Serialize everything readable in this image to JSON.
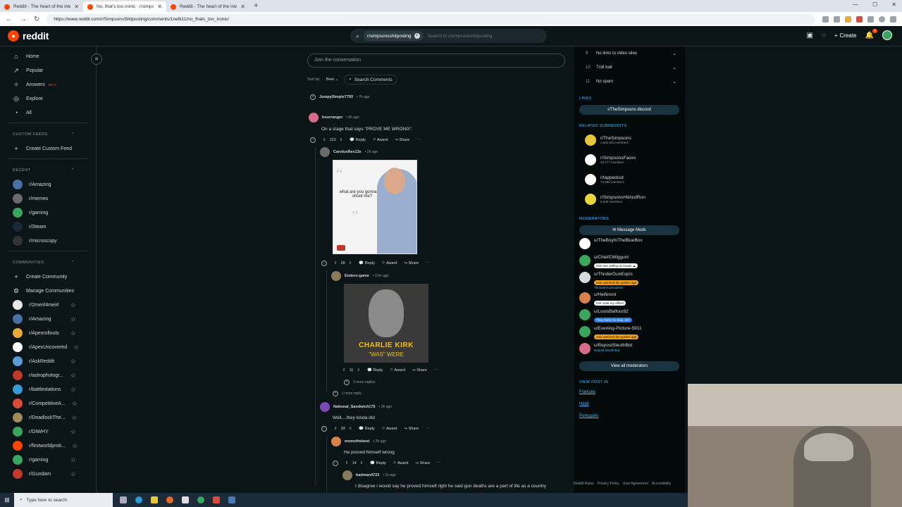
{
  "browser": {
    "tabs": [
      {
        "title": "Reddit - The heart of the internet",
        "active": false
      },
      {
        "title": "No, that's too ironic : r/simpsons...",
        "active": true
      },
      {
        "title": "Reddit - The heart of the internet",
        "active": false
      }
    ],
    "url": "https://www.reddit.com/r/SimpsonsShitposting/comments/1nefk11/no_thats_too_ironic/"
  },
  "header": {
    "logo": "reddit",
    "search_chip": "r/simpsonsshitposting",
    "search_placeholder": "Search in r/simpsonsshitposting",
    "create_label": "Create",
    "notif_count": "1"
  },
  "sidebar": {
    "nav": [
      {
        "label": "Home",
        "icon": "home-icon"
      },
      {
        "label": "Popular",
        "icon": "popular-icon"
      },
      {
        "label": "Answers",
        "icon": "answers-icon",
        "badge": "BETA"
      },
      {
        "label": "Explore",
        "icon": "explore-icon"
      },
      {
        "label": "All",
        "icon": "all-icon"
      }
    ],
    "custom_feeds_title": "CUSTOM FEEDS",
    "create_custom_feed": "Create Custom Feed",
    "recent_title": "RECENT",
    "recent": [
      {
        "label": "r/Amazing",
        "color": "#4a6fa5"
      },
      {
        "label": "r/memes",
        "color": "#6b6b6b"
      },
      {
        "label": "r/gaming",
        "color": "#3aa55d"
      },
      {
        "label": "r/Steam",
        "color": "#1b2838"
      },
      {
        "label": "r/microscopy",
        "color": "#333333"
      }
    ],
    "communities_title": "COMMUNITIES",
    "create_community": "Create Community",
    "manage_communities": "Manage Communities",
    "communities": [
      {
        "label": "r/2meirl4meirl",
        "color": "#e8e8e8"
      },
      {
        "label": "r/Amazing",
        "color": "#4a6fa5"
      },
      {
        "label": "r/Apexrollouts",
        "color": "#e8a83a"
      },
      {
        "label": "r/ApexUncovered",
        "color": "#ffffff"
      },
      {
        "label": "r/AskReddit",
        "color": "#5b9bd5"
      },
      {
        "label": "r/astrophotogr...",
        "color": "#c0392b"
      },
      {
        "label": "r/battlestations",
        "color": "#3a9ad9"
      },
      {
        "label": "r/CompetitiveA...",
        "color": "#d94a3a"
      },
      {
        "label": "r/DeadlockThe...",
        "color": "#a08a5a"
      },
      {
        "label": "r/DIWHY",
        "color": "#3aa55d"
      },
      {
        "label": "r/firstworldprob...",
        "color": "#ff4500"
      },
      {
        "label": "r/gaming",
        "color": "#3aa55d"
      },
      {
        "label": "r/Gundam",
        "color": "#c0392b"
      }
    ]
  },
  "main": {
    "join_placeholder": "Join the conversation",
    "sort_by_label": "Sort by:",
    "sort_value": "Best",
    "search_comments": "Search Comments",
    "collapsed_user": "JumpySimple7793",
    "collapsed_age": "7h ago",
    "comments": [
      {
        "user": "hourranger",
        "age": "6h ago",
        "text": "On a stage that says \"PROVE ME WRONG\".",
        "votes": "122",
        "color": "#d86a8a"
      },
      {
        "user": "CarolusRex13x",
        "age": "2h ago",
        "votes": "28",
        "color": "#6b6b6b",
        "meme_quote": "what are you gonna do? shoot me?"
      },
      {
        "user": "Enders-game",
        "age": "21m ago",
        "votes": "11",
        "color": "#8a7a5a",
        "meme_caption_1": "CHARLIE KIRK",
        "meme_caption_2": "\"WAS\" WERE"
      },
      {
        "user": "National_Sandwich175",
        "age": "3h ago",
        "text": "Well....they kinda did",
        "votes": "33",
        "color": "#7b4ab5"
      },
      {
        "user": "momzthebest",
        "age": "2h ago",
        "text": "He proved himself wrong",
        "votes": "14",
        "color": "#d9814a"
      },
      {
        "user": "badman4723",
        "age": "1h ago",
        "text": "I disagree i would say he proved himself right he said gun deaths are a part of life as a country",
        "color": "#8a7a5a"
      }
    ],
    "more_replies_3": "3 more replies",
    "more_reply_1": "1 more reply",
    "reply": "Reply",
    "award": "Award",
    "share": "Share"
  },
  "right": {
    "rules": [
      {
        "num": "9",
        "label": "No links to video sites"
      },
      {
        "num": "10",
        "label": "Troll bait"
      },
      {
        "num": "11",
        "label": "No spam"
      }
    ],
    "links_title": "LINKS",
    "discord": "r/TheSimpsons discord",
    "related_title": "RELATED SUBREDDITS",
    "related": [
      {
        "name": "r/TheSimpsons",
        "members": "1,602,623 members",
        "color": "#e8c53a"
      },
      {
        "name": "r/SimpsonsFaces",
        "members": "49,277 members",
        "color": "#ffffff"
      },
      {
        "name": "r/tappedout",
        "members": "73,590 members",
        "color": "#ffffff"
      },
      {
        "name": "r/SimpsonsHitAndRun",
        "members": "5,838 members",
        "color": "#e8d53a"
      }
    ],
    "moderators_title": "MODERATORS",
    "message_mods": "Message Mods",
    "mods": [
      {
        "name": "u/TheBoyInTheBlueBox",
        "flair": "",
        "color": "#ffffff"
      },
      {
        "name": "u/ChiefCWiggum",
        "flair": "Old man yelling at clouds ☁",
        "flair_bg": "#ffffff",
        "flair_fg": "#111111",
        "color": "#3aa55d"
      },
      {
        "name": "u/ThnderGunExprs",
        "flair": "only watched the golden age",
        "flair_bg": "#f0a020",
        "flair_fg": "#111111",
        "sub": "ThunderGunExpress",
        "color": "#d7dadc"
      },
      {
        "name": "u/Heiferoni",
        "flair": "Get outta my office!",
        "flair_bg": "#ffffff",
        "flair_fg": "#111111",
        "color": "#d9814a"
      },
      {
        "name": "u/LouisBalfour82",
        "flair": "They think I'm slow, eh?",
        "flair_bg": "#2a7ae2",
        "flair_fg": "#ffffff",
        "color": "#3aa55d"
      },
      {
        "name": "u/Evening-Picture-5911",
        "flair": "only watched the golden age",
        "flair_bg": "#f0a020",
        "flair_fg": "#111111",
        "color": "#3aa55d"
      },
      {
        "name": "u/RepostSleuthBot",
        "flair": "",
        "sub": "Repost Sleuth Bot",
        "color": "#d86a8a"
      }
    ],
    "view_all_mods": "View all moderators",
    "view_post_in": "VIEW POST IN",
    "languages": [
      "Français",
      "Hindi",
      "Português"
    ],
    "footer": [
      "Reddit Rules",
      "Privacy Policy",
      "User Agreement",
      "Accessibility"
    ]
  },
  "taskbar": {
    "search_placeholder": "Type here to search"
  }
}
